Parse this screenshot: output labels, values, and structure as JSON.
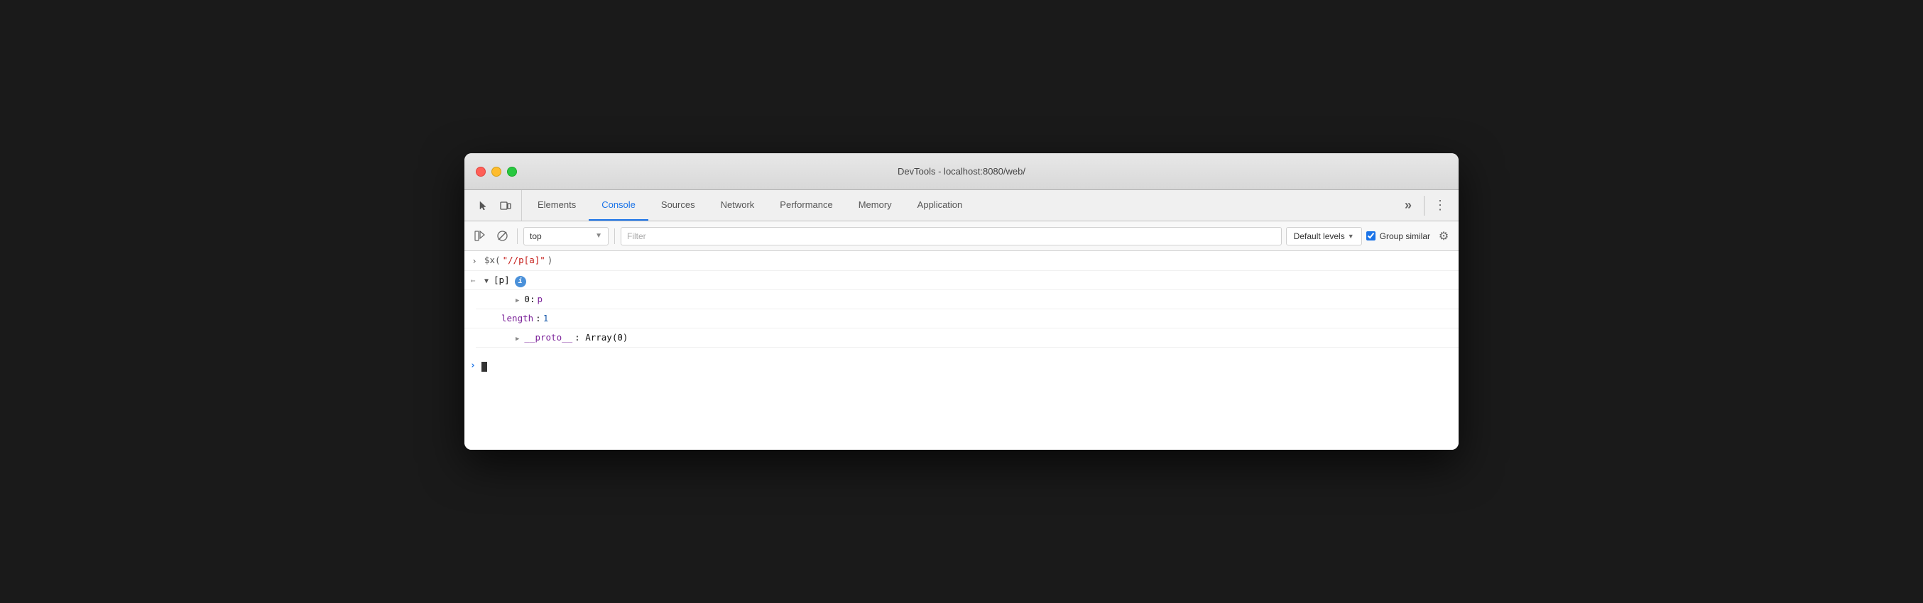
{
  "window": {
    "title": "DevTools - localhost:8080/web/"
  },
  "tabs": [
    {
      "id": "elements",
      "label": "Elements",
      "active": false
    },
    {
      "id": "console",
      "label": "Console",
      "active": true
    },
    {
      "id": "sources",
      "label": "Sources",
      "active": false
    },
    {
      "id": "network",
      "label": "Network",
      "active": false
    },
    {
      "id": "performance",
      "label": "Performance",
      "active": false
    },
    {
      "id": "memory",
      "label": "Memory",
      "active": false
    },
    {
      "id": "application",
      "label": "Application",
      "active": false
    }
  ],
  "toolbar": {
    "context_label": "top",
    "filter_placeholder": "Filter",
    "levels_label": "Default levels",
    "group_similar_label": "Group similar",
    "group_similar_checked": true
  },
  "console_lines": [
    {
      "type": "input",
      "gutter": ">",
      "content": "$x(\"//p[a]\")"
    },
    {
      "type": "output_parent",
      "gutter": "←",
      "content": "[p]",
      "expanded": true,
      "has_info": true
    },
    {
      "type": "child",
      "indent": 1,
      "content": "0: p"
    },
    {
      "type": "child_flat",
      "indent": 2,
      "label": "length",
      "value": "1"
    },
    {
      "type": "child",
      "indent": 1,
      "content": "__proto__: Array(0)"
    }
  ],
  "icons": {
    "cursor": "⬆",
    "layers": "⧉",
    "play": "▶",
    "no": "⊘",
    "chevron_right": "▶",
    "chevron_down": "▼",
    "chevron_left": "◀",
    "more": "»",
    "kebab": "⋮",
    "gear": "⚙"
  }
}
